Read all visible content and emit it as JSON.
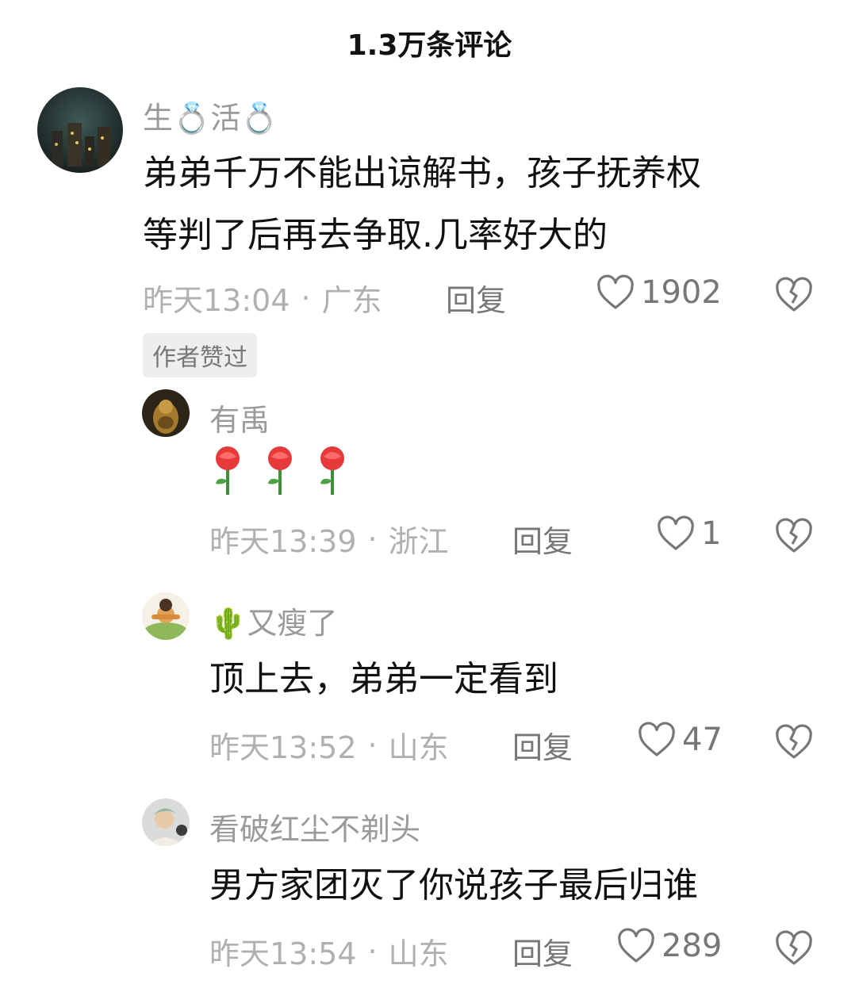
{
  "header": {
    "title": "1.3万条评论"
  },
  "comments": [
    {
      "username": "生💍活💍",
      "text_lines": [
        "弟弟千万不能出谅解书，孩子抚养权",
        "等判了后再去争取.几率好大的"
      ],
      "time": "昨天13:04",
      "region": "广东",
      "reply_label": "回复",
      "likes": "1902",
      "badge": "作者赞过"
    }
  ],
  "replies": [
    {
      "username": "有禹",
      "text": "🌹🌹🌹",
      "time": "昨天13:39",
      "region": "浙江",
      "reply_label": "回复",
      "likes": "1"
    },
    {
      "username": "🌵又瘦了",
      "text": "顶上去，弟弟一定看到",
      "time": "昨天13:52",
      "region": "山东",
      "reply_label": "回复",
      "likes": "47"
    },
    {
      "username": "看破红尘不剃头",
      "text": "男方家团灭了你说孩子最后归谁",
      "time": "昨天13:54",
      "region": "山东",
      "reply_label": "回复",
      "likes": "289"
    }
  ],
  "icons": {
    "like": "heart-outline-icon",
    "dislike": "broken-heart-icon",
    "separator": "·"
  },
  "colors": {
    "text": "#111111",
    "muted": "#9a9a9a",
    "meta": "#b0b0b0",
    "icon": "#777777"
  }
}
